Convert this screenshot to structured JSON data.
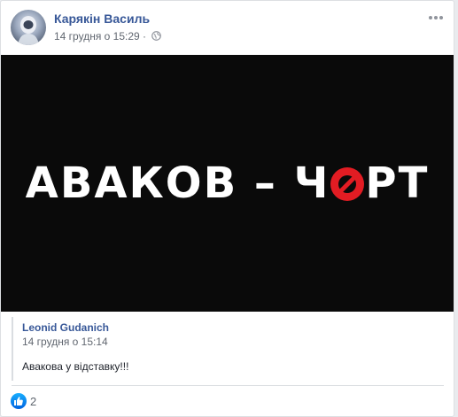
{
  "post": {
    "author": "Карякін Василь",
    "timestamp": "14 грудня о 15:29 ·",
    "privacy_icon": "globe-icon",
    "more_icon": "more-options-icon",
    "image": {
      "text_white": "АВАКОВ – Ч",
      "text_red": "РТ"
    }
  },
  "shared": {
    "author": "Leonid Gudanich",
    "timestamp": "14 грудня о 15:14",
    "body": "Авакова у відставку!!!"
  },
  "reactions": {
    "icon": "like-icon",
    "count": "2"
  },
  "colors": {
    "link": "#385898",
    "meta": "#616770",
    "accent_red": "#e21c23"
  }
}
